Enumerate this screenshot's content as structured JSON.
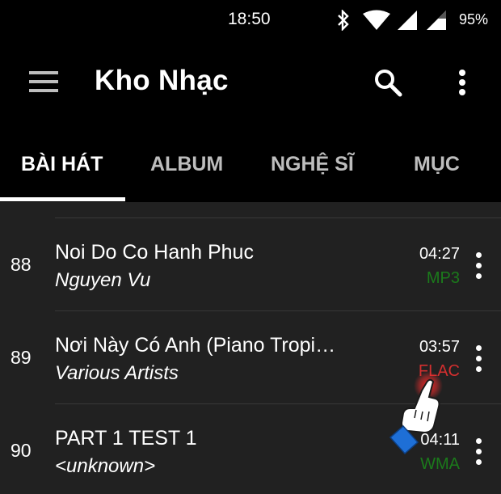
{
  "status_bar": {
    "time": "18:50",
    "battery": "95%",
    "icons": [
      "bluetooth-icon",
      "wifi-icon",
      "signal-icon",
      "signal-icon-2"
    ]
  },
  "app_bar": {
    "title": "Kho Nhạc",
    "icons": [
      "menu-icon",
      "search-icon",
      "overflow-menu-icon"
    ]
  },
  "tabs": [
    {
      "label": "BÀI HÁT",
      "active": true
    },
    {
      "label": "ALBUM",
      "active": false
    },
    {
      "label": "NGHỆ SĨ",
      "active": false
    },
    {
      "label": "MỤC",
      "active": false
    }
  ],
  "songs": [
    {
      "number": "88",
      "title": "Noi Do Co Hanh Phuc",
      "artist": "Nguyen Vu",
      "duration": "04:27",
      "format": "MP3",
      "format_color": "#1b7a1b"
    },
    {
      "number": "89",
      "title": "Nơi Này Có Anh (Piano Tropi…",
      "artist": "Various Artists",
      "duration": "03:57",
      "format": "FLAC",
      "format_color": "#d32f2f"
    },
    {
      "number": "90",
      "title": "PART 1 TEST 1",
      "artist": "<unknown>",
      "duration": "04:11",
      "format": "WMA",
      "format_color": "#1b7a1b"
    }
  ],
  "colors": {
    "background": "#000000",
    "list_background": "#212121",
    "lossy_format": "#1b7a1b",
    "lossless_format": "#d32f2f"
  }
}
